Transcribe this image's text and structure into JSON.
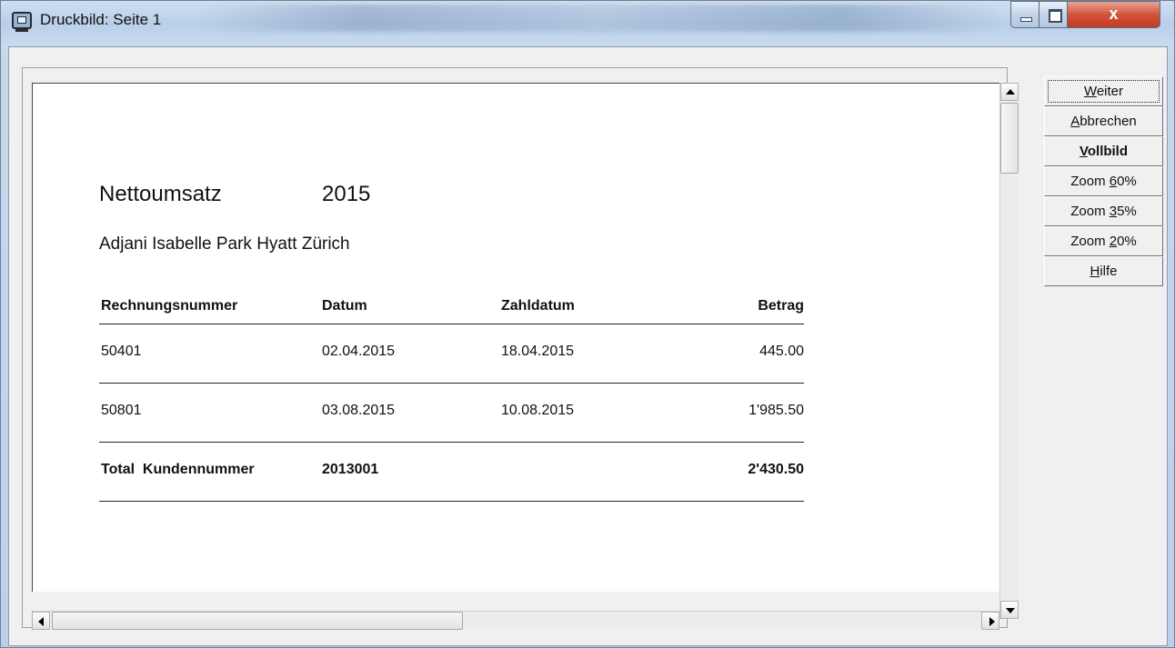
{
  "window": {
    "title": "Druckbild: Seite 1",
    "close_glyph": "x",
    "icons": {
      "app": "monitor-icon",
      "minimize": "minimize-icon",
      "maximize": "maximize-icon",
      "close": "close-icon"
    }
  },
  "report": {
    "title": "Nettoumsatz",
    "year": "2015",
    "subtitle": "Adjani Isabelle Park Hyatt Zürich",
    "columns": [
      "Rechnungsnummer",
      "Datum",
      "Zahldatum",
      "Betrag"
    ],
    "rows": [
      [
        "50401",
        "02.04.2015",
        "18.04.2015",
        "445.00"
      ],
      [
        "50801",
        "03.08.2015",
        "10.08.2015",
        "1'985.50"
      ]
    ],
    "total": [
      "Total  Kundennummer",
      "2013001",
      "",
      "2'430.50"
    ]
  },
  "buttons": [
    {
      "pre": "",
      "key": "W",
      "post": "eiter",
      "bold": false
    },
    {
      "pre": "",
      "key": "A",
      "post": "bbrechen",
      "bold": false
    },
    {
      "pre": "",
      "key": "V",
      "post": "ollbild",
      "bold": true
    },
    {
      "pre": "Zoom ",
      "key": "6",
      "post": "0%",
      "bold": false
    },
    {
      "pre": "Zoom ",
      "key": "3",
      "post": "5%",
      "bold": false
    },
    {
      "pre": "Zoom ",
      "key": "2",
      "post": "0%",
      "bold": false
    },
    {
      "pre": "",
      "key": "H",
      "post": "ilfe",
      "bold": false
    }
  ]
}
